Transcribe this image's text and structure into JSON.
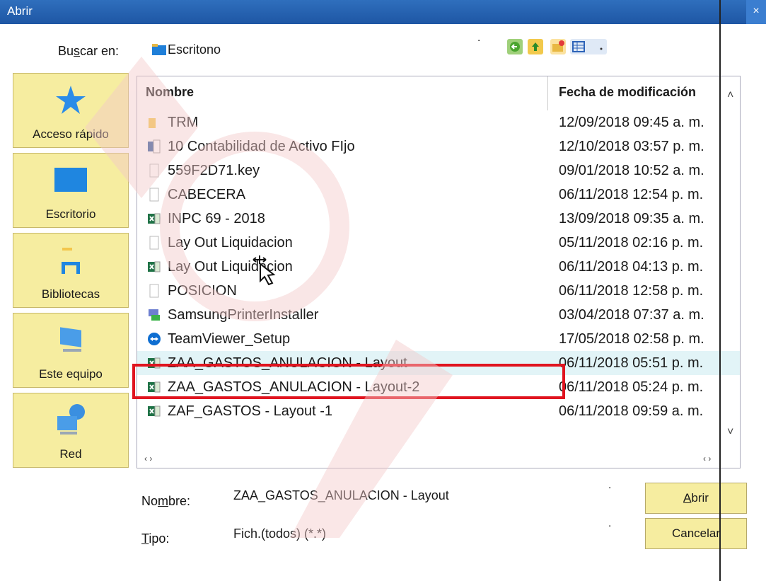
{
  "window": {
    "title": "Abrir",
    "close_glyph": "×"
  },
  "lookin": {
    "label_pre": "Bu",
    "label_ul": "s",
    "label_post": "car en:",
    "value": "Escritono",
    "icons": [
      "folder-icon",
      "back-icon",
      "up-folder-icon",
      "new-folder-icon",
      "view-menu-icon"
    ]
  },
  "places": [
    {
      "label": "Acceso rápido",
      "icon": "star-icon"
    },
    {
      "label": "Escritorio",
      "icon": "desktop-icon"
    },
    {
      "label": "Bibliotecas",
      "icon": "library-icon"
    },
    {
      "label": "Este equipo",
      "icon": "computer-icon"
    },
    {
      "label": "Red",
      "icon": "network-icon"
    }
  ],
  "file_list": {
    "columns": {
      "name": "Nombre",
      "date": "Fecha de modificación"
    },
    "rows": [
      {
        "name": "TRM",
        "date": "12/09/2018 09:45 a. m.",
        "icon": "folder-icon"
      },
      {
        "name": "10 Contabilidad de Activo FIjo",
        "date": "12/10/2018 03:57 p. m.",
        "icon": "word-doc-icon"
      },
      {
        "name": "559F2D71.key",
        "date": "09/01/2018 10:52 a. m.",
        "icon": "blank-file-icon"
      },
      {
        "name": "CABECERA",
        "date": "06/11/2018 12:54 p. m.",
        "icon": "blank-file-icon"
      },
      {
        "name": "INPC 69 - 2018",
        "date": "13/09/2018 09:35 a. m.",
        "icon": "excel-icon"
      },
      {
        "name": "Lay Out Liquidacion",
        "date": "05/11/2018 02:16 p. m.",
        "icon": "blank-file-icon"
      },
      {
        "name": "Lay Out Liquidacion",
        "date": "06/11/2018 04:13 p. m.",
        "icon": "excel-icon"
      },
      {
        "name": "POSICION",
        "date": "06/11/2018 12:58 p. m.",
        "icon": "blank-file-icon"
      },
      {
        "name": "SamsungPrinterInstaller",
        "date": "03/04/2018 07:37 a. m.",
        "icon": "installer-icon"
      },
      {
        "name": "TeamViewer_Setup",
        "date": "17/05/2018 02:58 p. m.",
        "icon": "teamviewer-icon"
      },
      {
        "name": "ZAA_GASTOS_ANULACION - Layout",
        "date": "06/11/2018 05:51 p. m.",
        "icon": "excel-icon",
        "selected": true
      },
      {
        "name": "ZAA_GASTOS_ANULACION - Layout-2",
        "date": "06/11/2018 05:24 p. m.",
        "icon": "excel-icon"
      },
      {
        "name": "ZAF_GASTOS - Layout -1",
        "date": "06/11/2018 09:59 a. m.",
        "icon": "excel-icon"
      }
    ]
  },
  "filename": {
    "label_pre": "No",
    "label_ul": "m",
    "label_post": "bre:",
    "value": "ZAA_GASTOS_ANULACION - Layout"
  },
  "filetype": {
    "label_ul": "T",
    "label_post": "ipo:",
    "value": "Fich.(todos) (*.*)"
  },
  "buttons": {
    "open_ul": "A",
    "open_rest": "brir",
    "cancel": "Cancelar"
  },
  "colors": {
    "title_bar": "#1e56a4",
    "places_bg": "#f6eda0",
    "selection": "#e2f4f7",
    "highlight_box": "#e0141f"
  }
}
